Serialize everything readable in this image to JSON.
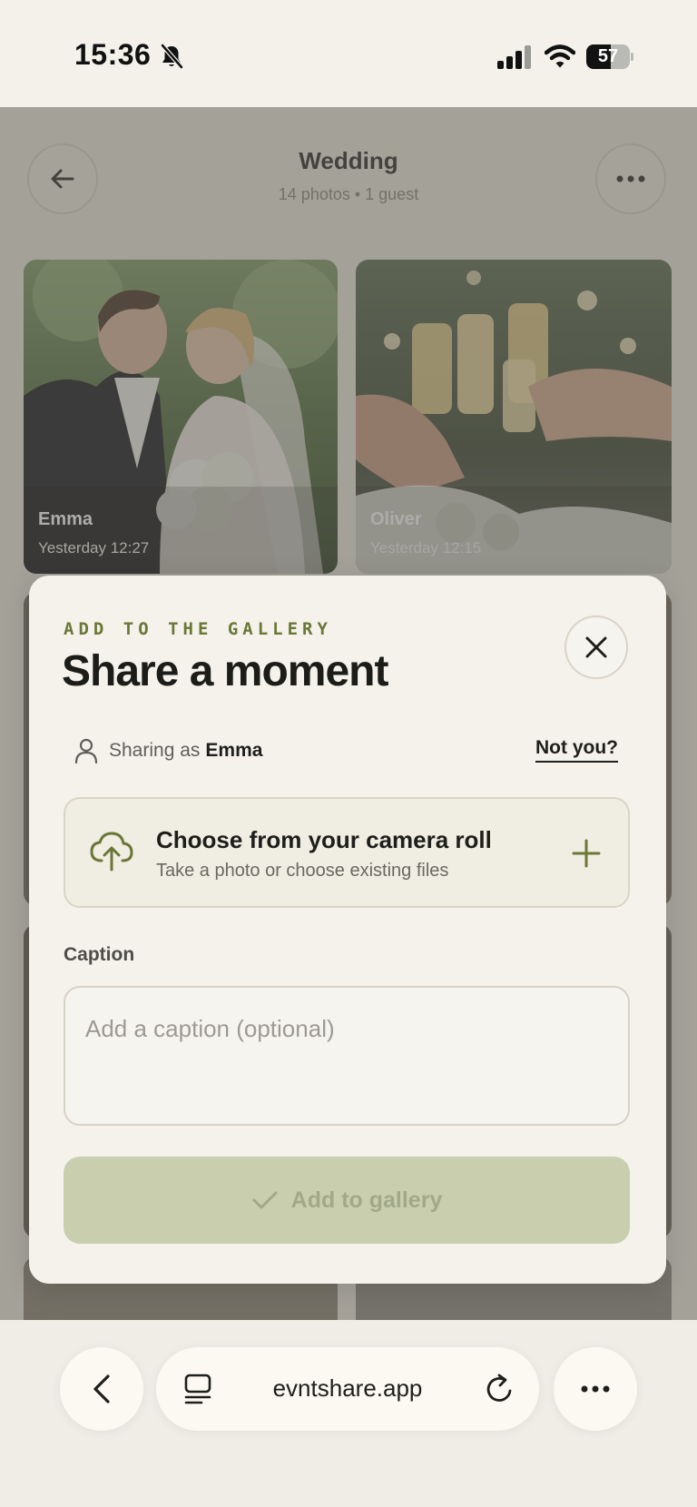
{
  "status_bar": {
    "time": "15:36",
    "battery": "57",
    "battery_level": 0.57
  },
  "gallery": {
    "title": "Wedding",
    "subtitle": "14 photos • 1 guest",
    "photos": [
      {
        "author": "Emma",
        "time": "Yesterday 12:27"
      },
      {
        "author": "Oliver",
        "time": "Yesterday 12:15"
      }
    ]
  },
  "modal": {
    "eyebrow": "ADD TO THE GALLERY",
    "title": "Share a moment",
    "sharing_label": "Sharing as",
    "sharing_name": "Emma",
    "not_you": "Not you?",
    "upload_title": "Choose from your camera roll",
    "upload_subtitle": "Take a photo or choose existing files",
    "caption_label": "Caption",
    "caption_placeholder": "Add a caption (optional)",
    "caption_value": "",
    "submit_label": "Add to gallery"
  },
  "browser": {
    "url": "evntshare.app"
  },
  "colors": {
    "accent": "#6b7736",
    "background": "#f3f1ea",
    "button_disabled": "#c9cfae"
  }
}
